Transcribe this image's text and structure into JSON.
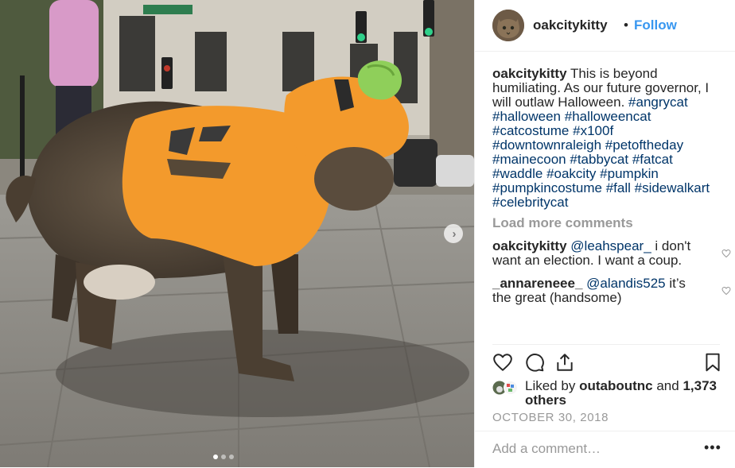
{
  "post": {
    "username": "oakcitykitty",
    "follow_separator": "•",
    "follow_label": "Follow",
    "caption_text": "This is beyond humiliating. As our future governor, I will outlaw Halloween.",
    "hashtags": [
      "#angrycat",
      "#halloween",
      "#halloweencat",
      "#catcostume",
      "#x100f",
      "#downtownraleigh",
      "#petoftheday",
      "#mainecoon",
      "#tabbycat",
      "#fatcat",
      "#waddle",
      "#oakcity",
      "#pumpkin",
      "#pumpkincostume",
      "#fall",
      "#sidewalkart",
      "#celebritycat"
    ]
  },
  "load_more_label": "Load more comments",
  "comments": [
    {
      "username": "oakcitykitty",
      "mention": "@leahspear_",
      "text": "i don't want an election. I want a coup."
    },
    {
      "username": "_annareneee_",
      "mention": "@alandis525",
      "text": "it’s the great (handsome)"
    }
  ],
  "likes": {
    "prefix": "Liked by",
    "user": "outaboutnc",
    "conjunction": "and",
    "count": "1,373 others"
  },
  "date": "OCTOBER 30, 2018",
  "add_comment_placeholder": "Add a comment…",
  "more_label": "•••",
  "carousel": {
    "next_label": "›",
    "slides": 3,
    "active_slide": 0
  },
  "icons": {
    "like": "heart-icon",
    "comment": "comment-bubble-icon",
    "share": "share-icon",
    "save": "bookmark-icon",
    "next": "chevron-right-icon"
  },
  "colors": {
    "link": "#003569",
    "follow": "#3897f0",
    "muted": "#999999",
    "text": "#262626",
    "costume_orange": "#f39a2c"
  }
}
